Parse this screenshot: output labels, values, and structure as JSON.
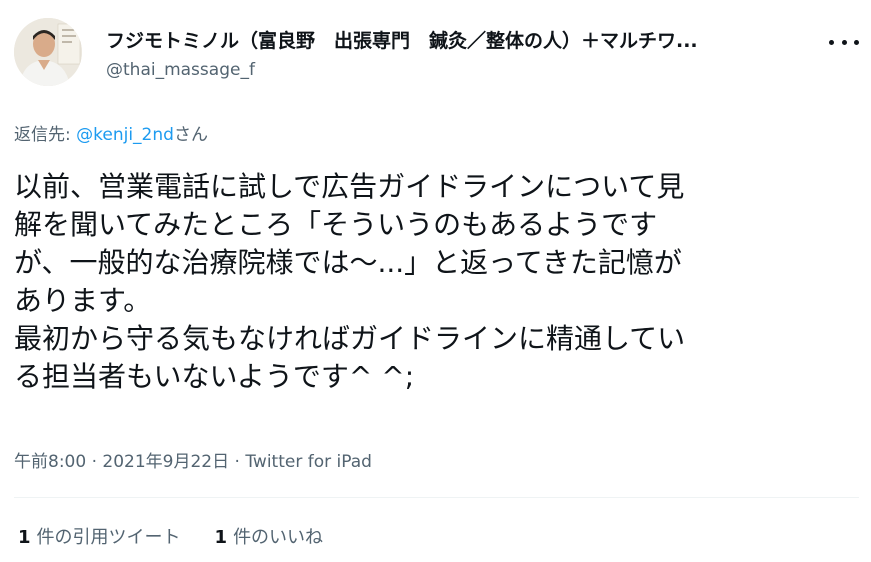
{
  "author": {
    "display_name": "フジモトミノル（富良野　出張専門　鍼灸／整体の人）＋マルチワ...",
    "handle": "@thai_massage_f",
    "avatar_icon": "profile-photo"
  },
  "reply": {
    "prefix": "返信先: ",
    "mention": "@kenji_2nd",
    "suffix": "さん"
  },
  "tweet": {
    "lines": [
      "以前、営業電話に試しで広告ガイドラインについて見",
      "解を聞いてみたところ「そういうのもあるようです",
      "が、一般的な治療院様では～...」と返ってきた記憶が",
      "あります。",
      "最初から守る気もなければガイドラインに精通してい",
      "る担当者もいないようです^ ^;"
    ]
  },
  "meta": {
    "time": "午前8:00",
    "sep1": " · ",
    "date": "2021年9月22日",
    "sep2": " · ",
    "source": "Twitter for iPad"
  },
  "stats": {
    "quotes_count": "1",
    "quotes_label": "件の引用ツイート",
    "likes_count": "1",
    "likes_label": "件のいいね"
  },
  "colors": {
    "text": "#0f1419",
    "secondary": "#536471",
    "accent": "#1d9bf0",
    "divider": "#eff3f4"
  }
}
